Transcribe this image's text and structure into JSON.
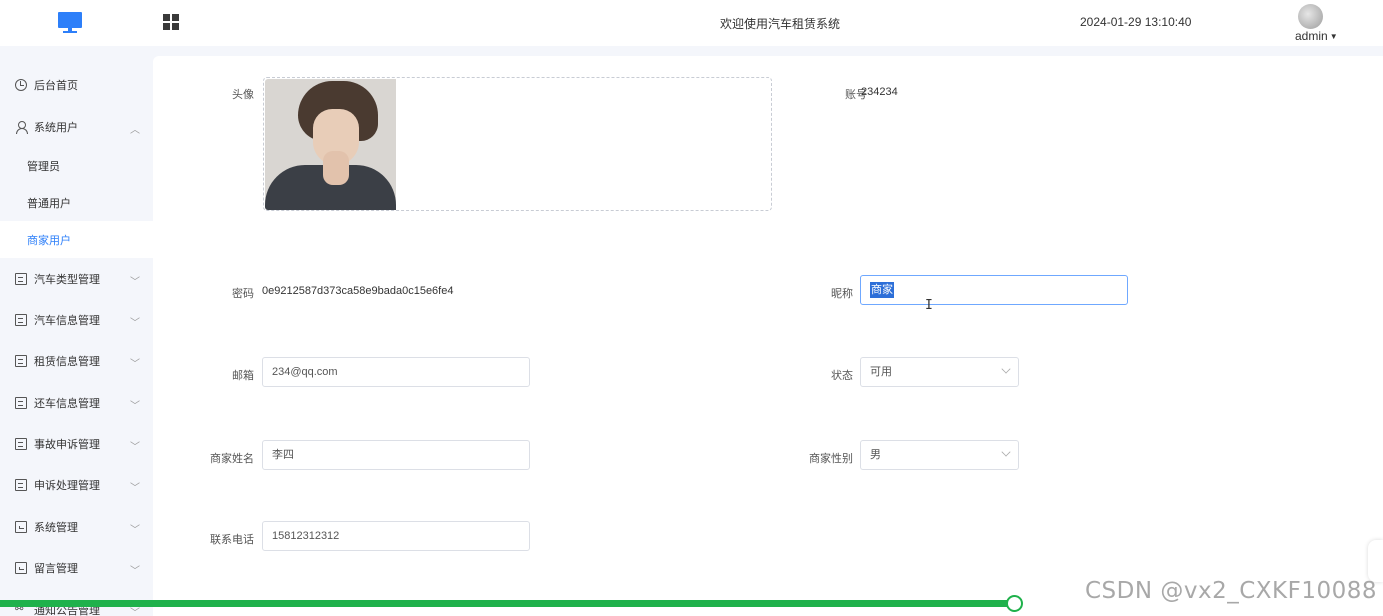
{
  "header": {
    "title": "欢迎使用汽车租赁系统",
    "datetime": "2024-01-29 13:10:40",
    "username": "admin",
    "logo_icon": "monitor-icon",
    "menu_icon": "grid-icon"
  },
  "sidebar": {
    "items": [
      {
        "label": "后台首页",
        "icon": "clock-icon"
      },
      {
        "label": "系统用户",
        "icon": "user-icon",
        "expanded": true
      },
      {
        "label": "管理员",
        "sub": true
      },
      {
        "label": "普通用户",
        "sub": true
      },
      {
        "label": "商家用户",
        "sub": true,
        "active": true
      },
      {
        "label": "汽车类型管理",
        "icon": "box-icon"
      },
      {
        "label": "汽车信息管理",
        "icon": "box-icon"
      },
      {
        "label": "租赁信息管理",
        "icon": "box-icon"
      },
      {
        "label": "还车信息管理",
        "icon": "box-icon"
      },
      {
        "label": "事故申诉管理",
        "icon": "box-icon"
      },
      {
        "label": "申诉处理管理",
        "icon": "box-icon"
      },
      {
        "label": "系统管理",
        "icon": "folder-icon"
      },
      {
        "label": "留言管理",
        "icon": "folder-icon"
      },
      {
        "label": "通知公告管理",
        "icon": "share-icon"
      }
    ]
  },
  "form": {
    "avatar_label": "头像",
    "account_label": "账号",
    "account_value": "234234",
    "password_label": "密码",
    "password_value": "0e9212587d373ca58e9bada0c15e6fe4",
    "nickname_label": "昵称",
    "nickname_value": "商家",
    "email_label": "邮箱",
    "email_value": "234@qq.com",
    "status_label": "状态",
    "status_value": "可用",
    "merchant_name_label": "商家姓名",
    "merchant_name_value": "李四",
    "merchant_gender_label": "商家性别",
    "merchant_gender_value": "男",
    "phone_label": "联系电话",
    "phone_value": "15812312312"
  },
  "video": {
    "progress": 0.733,
    "accent": "#1fb14b"
  },
  "watermark": "CSDN @vx2_CXKF10088",
  "colors": {
    "accent": "#2d7ff9",
    "active_text": "#2d7ff9",
    "selection": "#2d6fd8"
  }
}
